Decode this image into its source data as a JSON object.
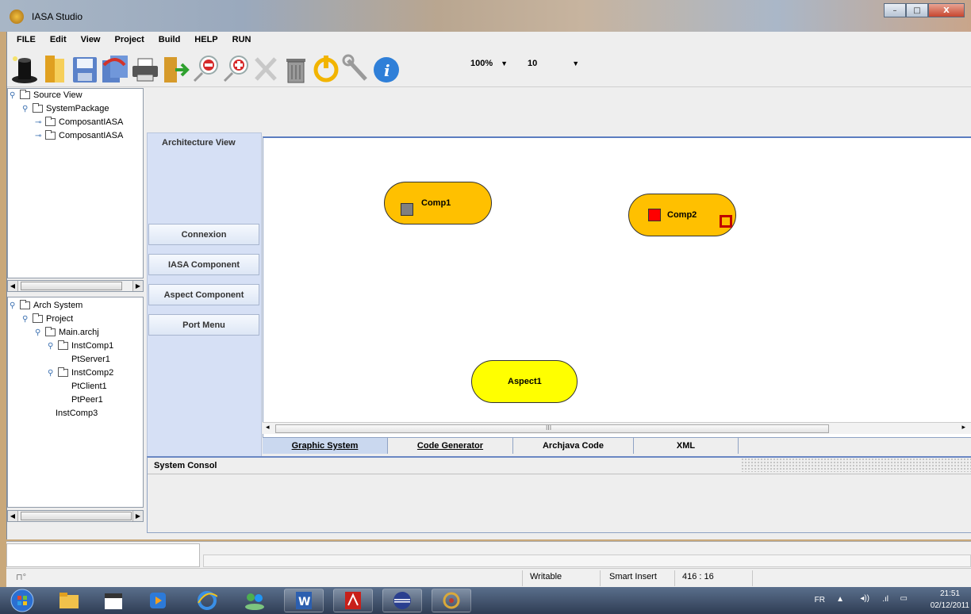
{
  "window": {
    "title": "IASA Studio",
    "minimize": "–",
    "maximize": "□",
    "close": "X"
  },
  "menu": [
    "FILE",
    "Edit",
    "View",
    "Project",
    "Build",
    "HELP",
    "RUN"
  ],
  "toolbar": {
    "zoom_value": "100%",
    "grid_value": "10",
    "icons": [
      "wizard-hat-icon",
      "open-folder-icon",
      "save-icon",
      "save-all-icon",
      "print-icon",
      "exit-door-icon",
      "zoom-out-icon",
      "zoom-in-icon",
      "delete-icon",
      "trash-icon",
      "power-icon",
      "wrench-icon",
      "info-icon"
    ]
  },
  "source_tree": {
    "items": [
      {
        "label": "Source View"
      },
      {
        "label": "SystemPackage"
      },
      {
        "label": "ComposantIASA"
      },
      {
        "label": "ComposantIASA"
      }
    ]
  },
  "arch_tree": {
    "items": [
      {
        "label": "Arch System"
      },
      {
        "label": "Project"
      },
      {
        "label": "Main.archj"
      },
      {
        "label": "InstComp1"
      },
      {
        "label": "PtServer1"
      },
      {
        "label": "InstComp2"
      },
      {
        "label": "PtClient1"
      },
      {
        "label": "PtPeer1"
      },
      {
        "label": "InstComp3"
      }
    ]
  },
  "palette": {
    "title": "Architecture View",
    "buttons": [
      "Connexion",
      "IASA Component",
      "Aspect Component",
      "Port Menu"
    ]
  },
  "canvas": {
    "nodes": [
      {
        "label": "Comp1",
        "port_color": "#808080"
      },
      {
        "label": "Comp2",
        "port_color": "#ff0000"
      },
      {
        "label": "Aspect1"
      }
    ],
    "colors": {
      "component": "#ffc000",
      "aspect": "#ffff00"
    },
    "scroll_glyph": "III"
  },
  "tabs": [
    "Graphic System",
    "Code Generator",
    "Archjava Code",
    "XML"
  ],
  "console": {
    "title": "System Consol"
  },
  "statusbar": {
    "mode": "Writable",
    "insert": "Smart Insert",
    "position": "416 : 16"
  },
  "taskbar": {
    "tray_lang": "FR",
    "time": "21:51",
    "date": "02/12/2011"
  }
}
